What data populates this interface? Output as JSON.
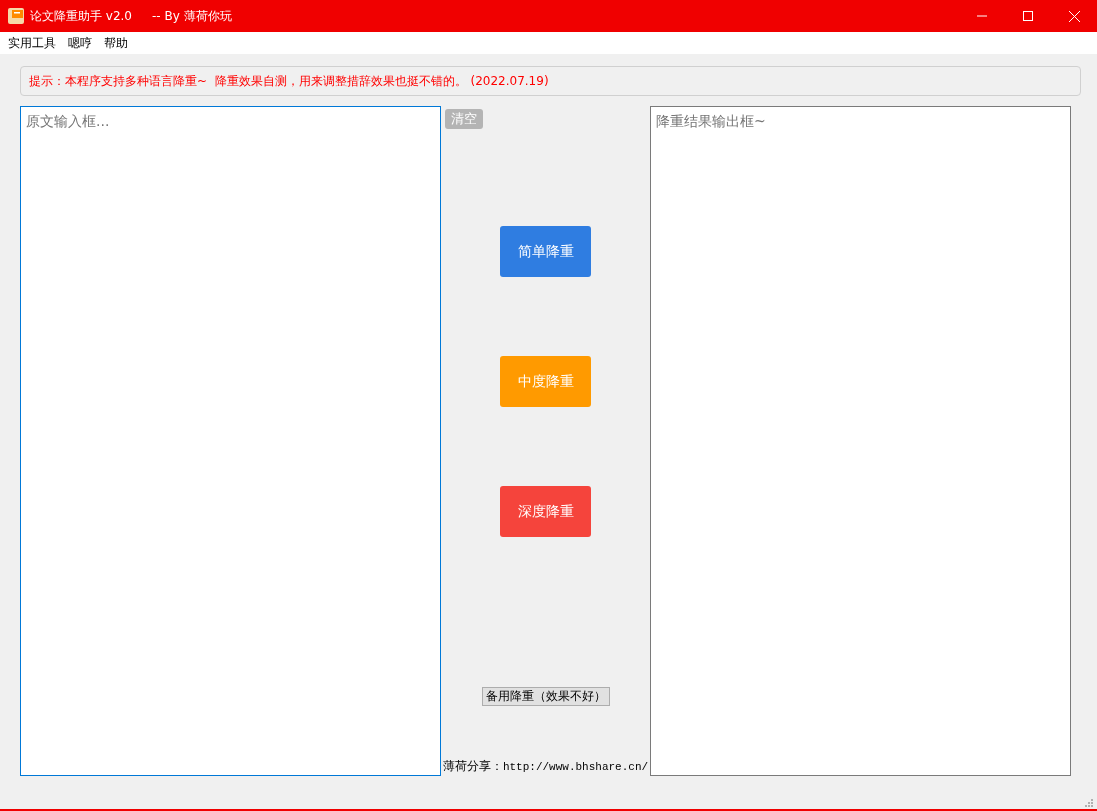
{
  "window": {
    "title": "论文降重助手 v2.0",
    "subtitle": "-- By 薄荷你玩"
  },
  "menu": [
    {
      "label": "实用工具"
    },
    {
      "label": "嗯哼"
    },
    {
      "label": "帮助"
    }
  ],
  "notice": "提示：本程序支持多种语言降重~  降重效果自测，用来调整措辞效果也挺不错的。 (2022.07.19)",
  "input": {
    "placeholder": "原文输入框..."
  },
  "clear_button": {
    "label": "清空",
    "disabled": true
  },
  "actions": [
    {
      "label": "简单降重",
      "color": "#2f7de1"
    },
    {
      "label": "中度降重",
      "color": "#ff9a00"
    },
    {
      "label": "深度降重",
      "color": "#f5443c"
    }
  ],
  "backup_button": {
    "label": "备用降重（效果不好）"
  },
  "share": {
    "label": "薄荷分享：",
    "url": "http://www.bhshare.cn/"
  },
  "output": {
    "placeholder": "降重结果输出框~"
  }
}
